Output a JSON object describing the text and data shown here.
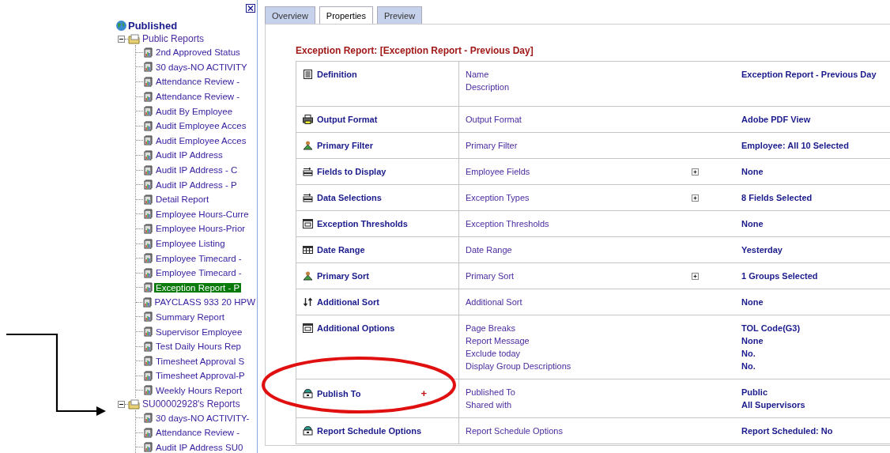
{
  "tree": {
    "label": "Published",
    "children": [
      {
        "label": "Public Reports",
        "expanded": true,
        "children": [
          {
            "label": "2nd Approved Status",
            "selected": false
          },
          {
            "label": "30 days-NO ACTIVITY",
            "selected": false
          },
          {
            "label": "Attendance Review -",
            "selected": false
          },
          {
            "label": "Attendance Review -",
            "selected": false
          },
          {
            "label": "Audit By Employee",
            "selected": false
          },
          {
            "label": "Audit Employee Acces",
            "selected": false
          },
          {
            "label": "Audit Employee Acces",
            "selected": false
          },
          {
            "label": "Audit IP Address",
            "selected": false
          },
          {
            "label": "Audit IP Address - C",
            "selected": false
          },
          {
            "label": "Audit IP Address - P",
            "selected": false
          },
          {
            "label": "Detail Report",
            "selected": false
          },
          {
            "label": "Employee Hours-Curre",
            "selected": false
          },
          {
            "label": "Employee Hours-Prior",
            "selected": false
          },
          {
            "label": "Employee Listing",
            "selected": false
          },
          {
            "label": "Employee Timecard -",
            "selected": false
          },
          {
            "label": "Employee Timecard -",
            "selected": false
          },
          {
            "label": "Exception Report - P",
            "selected": true
          },
          {
            "label": "PAYCLASS 933 20 HPW",
            "selected": false
          },
          {
            "label": "Summary Report",
            "selected": false
          },
          {
            "label": "Supervisor Employee",
            "selected": false
          },
          {
            "label": "Test Daily Hours Rep",
            "selected": false
          },
          {
            "label": "Timesheet Approval S",
            "selected": false
          },
          {
            "label": "Timesheet Approval-P",
            "selected": false
          },
          {
            "label": "Weekly Hours Report",
            "selected": false
          }
        ]
      },
      {
        "label": "SU00002928's Reports",
        "expanded": true,
        "children": [
          {
            "label": "30 days-NO ACTIVITY-",
            "selected": false
          },
          {
            "label": "Attendance Review -",
            "selected": false
          },
          {
            "label": "Audit IP Address SU0",
            "selected": false
          }
        ]
      }
    ]
  },
  "tabs": [
    {
      "label": "Overview",
      "selected": false
    },
    {
      "label": "Properties",
      "selected": true
    },
    {
      "label": "Preview",
      "selected": false
    }
  ],
  "report_title": "Exception Report: [Exception Report - Previous Day]",
  "rows": [
    {
      "label": "Definition",
      "fields": [
        "Name",
        "Description"
      ],
      "values": [
        "Exception Report - Previous Day"
      ],
      "expand_button": false
    },
    {
      "label": "Output Format",
      "fields": [
        "Output Format"
      ],
      "values": [
        "Adobe PDF View"
      ],
      "expand_button": false
    },
    {
      "label": "Primary Filter",
      "fields": [
        "Primary Filter"
      ],
      "values": [
        "Employee: All 10 Selected"
      ],
      "expand_button": false
    },
    {
      "label": "Fields to Display",
      "fields": [
        "Employee Fields"
      ],
      "values": [
        "None"
      ],
      "expand_button": true
    },
    {
      "label": "Data Selections",
      "fields": [
        "Exception Types"
      ],
      "values": [
        "8 Fields Selected"
      ],
      "expand_button": true
    },
    {
      "label": "Exception Thresholds",
      "fields": [
        "Exception Thresholds"
      ],
      "values": [
        "None"
      ],
      "expand_button": false
    },
    {
      "label": "Date Range",
      "fields": [
        "Date Range"
      ],
      "values": [
        "Yesterday"
      ],
      "expand_button": false
    },
    {
      "label": "Primary Sort",
      "fields": [
        "Primary Sort"
      ],
      "values": [
        "1 Groups Selected"
      ],
      "expand_button": true
    },
    {
      "label": "Additional Sort",
      "fields": [
        "Additional Sort"
      ],
      "values": [
        "None"
      ],
      "expand_button": false
    },
    {
      "label": "Additional Options",
      "fields": [
        "Page Breaks",
        "Report Message",
        "Exclude today",
        "Display Group Descriptions"
      ],
      "values": [
        "TOL Code(G3)",
        "None",
        "No.",
        "No."
      ],
      "expand_button": false
    },
    {
      "label": "Publish To",
      "action": "+",
      "fields": [
        "Published To",
        "Shared with"
      ],
      "values": [
        "Public",
        "All Supervisors"
      ],
      "expand_button": false
    },
    {
      "label": "Report Schedule Options",
      "fields": [
        "Report Schedule Options"
      ],
      "values": [
        "Report Scheduled: No"
      ],
      "expand_button": false
    }
  ]
}
